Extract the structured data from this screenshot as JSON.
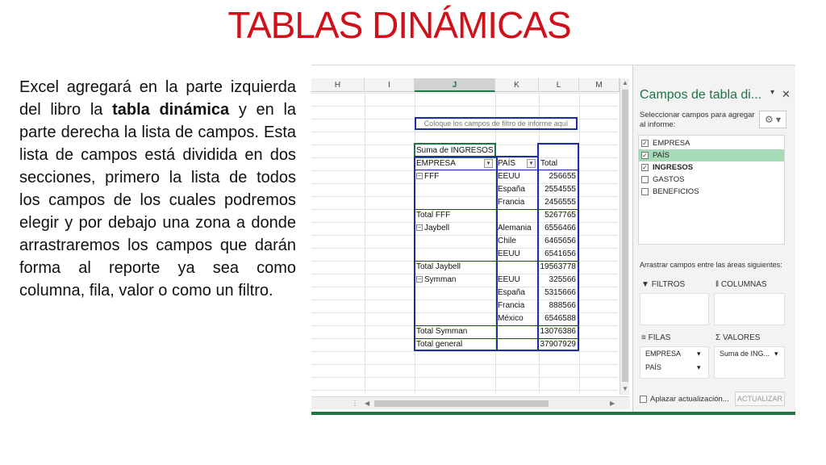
{
  "slide": {
    "title": "TABLAS DINÁMICAS",
    "paragraph": {
      "part1": "Excel agregará en la parte izquierda del libro la ",
      "bold1": "tabla dinámica",
      "part2": " y en la parte derecha la lista de campos. Esta lista de campos está dividida en dos secciones, primero la lista de todos los campos de los cuales podremos elegir y por debajo una zona a donde arrastraremos los campos que darán forma al reporte ya sea como columna, fila, valor o como un filtro."
    }
  },
  "excel": {
    "columns": [
      "H",
      "I",
      "J",
      "K",
      "L",
      "M"
    ],
    "selected_column": "J",
    "filter_placeholder": "Coloque los campos de filtro de informe aquí",
    "pivot": {
      "values_header": "Suma de INGRESOS",
      "row_headers": [
        "EMPRESA",
        "PAÍS",
        "Total"
      ],
      "rows": [
        {
          "empresa": "FFF",
          "pais": "EEUU",
          "total": "256655",
          "group_start": true
        },
        {
          "empresa": "",
          "pais": "España",
          "total": "2554555"
        },
        {
          "empresa": "",
          "pais": "Francia",
          "total": "2456555"
        },
        {
          "empresa": "Total FFF",
          "pais": "",
          "total": "5267765",
          "subtotal": true
        },
        {
          "empresa": "Jaybell",
          "pais": "Alemania",
          "total": "6556466",
          "group_start": true
        },
        {
          "empresa": "",
          "pais": "Chile",
          "total": "6465656"
        },
        {
          "empresa": "",
          "pais": "EEUU",
          "total": "6541656"
        },
        {
          "empresa": "Total Jaybell",
          "pais": "",
          "total": "19563778",
          "subtotal": true
        },
        {
          "empresa": "Symman",
          "pais": "EEUU",
          "total": "325566",
          "group_start": true
        },
        {
          "empresa": "",
          "pais": "España",
          "total": "5315666"
        },
        {
          "empresa": "",
          "pais": "Francia",
          "total": "888566"
        },
        {
          "empresa": "",
          "pais": "México",
          "total": "6546588"
        },
        {
          "empresa": "Total Symman",
          "pais": "",
          "total": "13076386",
          "subtotal": true
        },
        {
          "empresa": "Total general",
          "pais": "",
          "total": "37907929",
          "subtotal": true
        }
      ]
    },
    "field_pane": {
      "title": "Campos de tabla di...",
      "subtitle": "Seleccionar campos para agregar al informe:",
      "fields": [
        {
          "name": "EMPRESA",
          "checked": true,
          "highlighted": false
        },
        {
          "name": "PAÍS",
          "checked": true,
          "highlighted": true
        },
        {
          "name": "INGRESOS",
          "checked": true,
          "highlighted": false
        },
        {
          "name": "GASTOS",
          "checked": false,
          "highlighted": false
        },
        {
          "name": "BENEFICIOS",
          "checked": false,
          "highlighted": false
        }
      ],
      "drag_hint": "Arrastrar campos entre las áreas siguientes:",
      "areas": {
        "filters": "FILTROS",
        "columns": "COLUMNAS",
        "rows": "FILAS",
        "values": "VALORES"
      },
      "row_chips": [
        "EMPRESA",
        "PAÍS"
      ],
      "value_chips": [
        "Suma de ING..."
      ],
      "defer_label": "Aplazar actualización...",
      "update_button": "ACTUALIZAR"
    },
    "colors": {
      "accent_green": "#217346",
      "pivot_border": "#1f2fa3",
      "title_red": "#d0101a"
    }
  }
}
